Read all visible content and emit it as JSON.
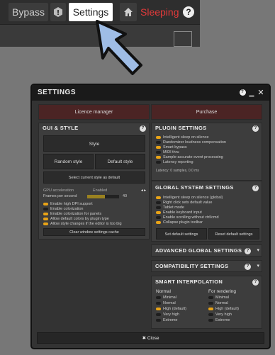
{
  "toolbar": {
    "bypass": "Bypass",
    "settings": "Settings",
    "sleeping": "Sleeping",
    "help": "?"
  },
  "window": {
    "title": "SETTINGS",
    "licence": "Licence manager",
    "purchase": "Purchase",
    "close": "✖ Close"
  },
  "gui": {
    "header": "GUI & STYLE",
    "style": "Style",
    "random_style": "Random style",
    "default_style": "Default style",
    "select_default": "Select current style as default",
    "gpu_label": "GPU acceleration",
    "gpu_value": "Enabled",
    "fps_label": "Frames per second",
    "fps_value": "40",
    "fps_fraction": 0.55,
    "options": [
      {
        "label": "Enable high DPI support",
        "on": true
      },
      {
        "label": "Enable colorization",
        "on": false
      },
      {
        "label": "Enable colorization for panels",
        "on": true
      },
      {
        "label": "Allow default colors by plugin type",
        "on": true
      },
      {
        "label": "Allow style changes if the editor is too big",
        "on": true
      }
    ],
    "clear_cache": "Clear window settings cache"
  },
  "plugin": {
    "header": "PLUGIN SETTINGS",
    "options": [
      {
        "label": "Intelligent sleep on silence",
        "on": true
      },
      {
        "label": "Randomizer loudness compensation",
        "on": false
      },
      {
        "label": "Smart bypass",
        "on": true
      },
      {
        "label": "MIDI thru",
        "on": false
      },
      {
        "label": "Sample-accurate event processing",
        "on": true
      },
      {
        "label": "Latency reporting",
        "on": false
      }
    ],
    "latency": "Latency: 0 samples, 0.0 ms"
  },
  "global": {
    "header": "GLOBAL SYSTEM SETTINGS",
    "options": [
      {
        "label": "Intelligent sleep on silence (global)",
        "on": true
      },
      {
        "label": "Right click sets default value",
        "on": false
      },
      {
        "label": "Tablet mode",
        "on": false
      },
      {
        "label": "Enable keyboard input",
        "on": true
      },
      {
        "label": "Enable scrolling without ctrl/cmd",
        "on": false
      },
      {
        "label": "Collapse plugin toolbar",
        "on": true
      }
    ],
    "set_default": "Set default settings",
    "reset_default": "Reset default settings"
  },
  "advanced": {
    "header": "ADVANCED GLOBAL SETTINGS"
  },
  "compat": {
    "header": "COMPATIBILITY SETTINGS"
  },
  "smart": {
    "header": "SMART INTERPOLATION",
    "normal_head": "Normal",
    "render_head": "For rendering",
    "normal": [
      {
        "label": "Minimal",
        "on": false
      },
      {
        "label": "Normal",
        "on": false
      },
      {
        "label": "High (default)",
        "on": true
      },
      {
        "label": "Very high",
        "on": false
      },
      {
        "label": "Extreme",
        "on": false
      }
    ],
    "render": [
      {
        "label": "Minimal",
        "on": false
      },
      {
        "label": "Normal",
        "on": false
      },
      {
        "label": "High (default)",
        "on": true
      },
      {
        "label": "Very high",
        "on": false
      },
      {
        "label": "Extreme",
        "on": false
      }
    ]
  },
  "colors": {
    "accent": "#e8a317",
    "sleeping": "#e23a3a",
    "licence_bg": "#4b2424",
    "arrow": "#9fbde6"
  }
}
